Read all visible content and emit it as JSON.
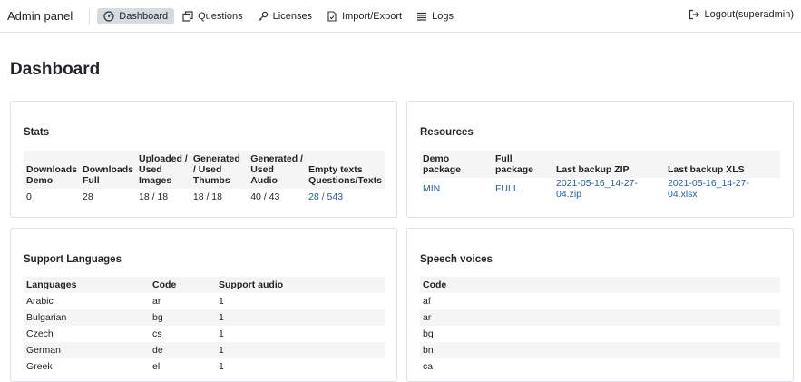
{
  "nav": {
    "brand": "Admin panel",
    "items": [
      {
        "label": "Dashboard",
        "icon": "dashboard-icon",
        "active": true
      },
      {
        "label": "Questions",
        "icon": "copy-icon"
      },
      {
        "label": "Licenses",
        "icon": "key-icon"
      },
      {
        "label": "Import/Export",
        "icon": "file-check-icon"
      },
      {
        "label": "Logs",
        "icon": "list-icon"
      }
    ],
    "logout": "Logout(superadmin)"
  },
  "page_title": "Dashboard",
  "stats": {
    "title": "Stats",
    "headers": [
      "Downloads Demo",
      "Downloads Full",
      "Uploaded / Used Images",
      "Generated / Used Thumbs",
      "Generated / Used Audio",
      "Empty texts Questions/Texts"
    ],
    "row": [
      "0",
      "28",
      "18 / 18",
      "18 / 18",
      "40 / 43",
      "28 / 543"
    ]
  },
  "resources": {
    "title": "Resources",
    "headers": [
      "Demo package",
      "Full package",
      "Last backup ZIP",
      "Last backup XLS"
    ],
    "row": [
      "MIN",
      "FULL",
      "2021-05-16_14-27-04.zip",
      "2021-05-16_14-27-04.xlsx"
    ]
  },
  "languages": {
    "title": "Support Languages",
    "headers": [
      "Languages",
      "Code",
      "Support audio"
    ],
    "rows": [
      [
        "Arabic",
        "ar",
        "1"
      ],
      [
        "Bulgarian",
        "bg",
        "1"
      ],
      [
        "Czech",
        "cs",
        "1"
      ],
      [
        "German",
        "de",
        "1"
      ],
      [
        "Greek",
        "el",
        "1"
      ]
    ]
  },
  "voices": {
    "title": "Speech voices",
    "header": "Code",
    "rows": [
      "af",
      "ar",
      "bg",
      "bn",
      "ca"
    ]
  }
}
